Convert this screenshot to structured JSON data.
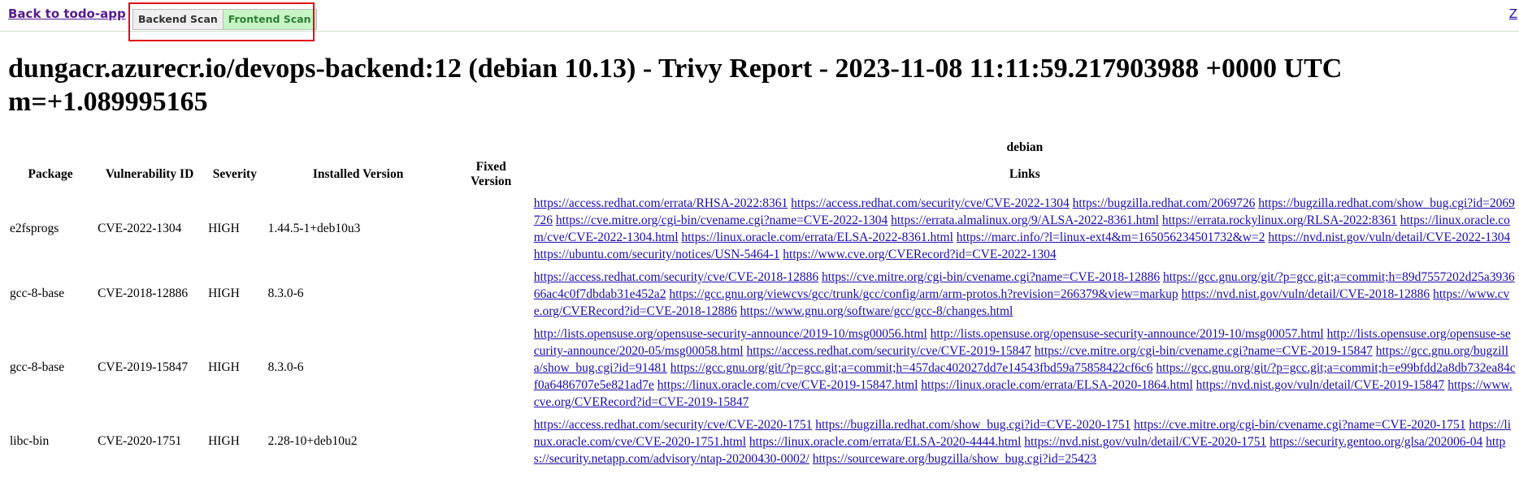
{
  "nav": {
    "back_label": "Back to todo-app",
    "right_cut_label": "Z",
    "tabs": [
      {
        "label": "Backend Scan"
      },
      {
        "label": "Frontend Scan"
      }
    ]
  },
  "report": {
    "title": "dungacr.azurecr.io/devops-backend:12 (debian 10.13) - Trivy Report - 2023-11-08 11:11:59.217903988 +0000 UTC m=+1.089995165"
  },
  "table": {
    "group_label": "debian",
    "headers": {
      "package": "Package",
      "vulnerability_id": "Vulnerability ID",
      "severity": "Severity",
      "installed_version": "Installed Version",
      "fixed_version": "Fixed Version",
      "links": "Links"
    },
    "rows": [
      {
        "package": "e2fsprogs",
        "vulnerability_id": "CVE-2022-1304",
        "severity": "HIGH",
        "installed_version": "1.44.5-1+deb10u3",
        "fixed_version": "",
        "links": [
          "https://access.redhat.com/errata/RHSA-2022:8361",
          "https://access.redhat.com/security/cve/CVE-2022-1304",
          "https://bugzilla.redhat.com/2069726",
          "https://bugzilla.redhat.com/show_bug.cgi?id=2069726",
          "https://cve.mitre.org/cgi-bin/cvename.cgi?name=CVE-2022-1304",
          "https://errata.almalinux.org/9/ALSA-2022-8361.html",
          "https://errata.rockylinux.org/RLSA-2022:8361",
          "https://linux.oracle.com/cve/CVE-2022-1304.html",
          "https://linux.oracle.com/errata/ELSA-2022-8361.html",
          "https://marc.info/?l=linux-ext4&m=165056234501732&w=2",
          "https://nvd.nist.gov/vuln/detail/CVE-2022-1304",
          "https://ubuntu.com/security/notices/USN-5464-1",
          "https://www.cve.org/CVERecord?id=CVE-2022-1304"
        ]
      },
      {
        "package": "gcc-8-base",
        "vulnerability_id": "CVE-2018-12886",
        "severity": "HIGH",
        "installed_version": "8.3.0-6",
        "fixed_version": "",
        "links": [
          "https://access.redhat.com/security/cve/CVE-2018-12886",
          "https://cve.mitre.org/cgi-bin/cvename.cgi?name=CVE-2018-12886",
          "https://gcc.gnu.org/git/?p=gcc.git;a=commit;h=89d7557202d25a393666ac4c0f7dbdab31e452a2",
          "https://gcc.gnu.org/viewcvs/gcc/trunk/gcc/config/arm/arm-protos.h?revision=266379&view=markup",
          "https://nvd.nist.gov/vuln/detail/CVE-2018-12886",
          "https://www.cve.org/CVERecord?id=CVE-2018-12886",
          "https://www.gnu.org/software/gcc/gcc-8/changes.html"
        ]
      },
      {
        "package": "gcc-8-base",
        "vulnerability_id": "CVE-2019-15847",
        "severity": "HIGH",
        "installed_version": "8.3.0-6",
        "fixed_version": "",
        "links": [
          "http://lists.opensuse.org/opensuse-security-announce/2019-10/msg00056.html",
          "http://lists.opensuse.org/opensuse-security-announce/2019-10/msg00057.html",
          "http://lists.opensuse.org/opensuse-security-announce/2020-05/msg00058.html",
          "https://access.redhat.com/security/cve/CVE-2019-15847",
          "https://cve.mitre.org/cgi-bin/cvename.cgi?name=CVE-2019-15847",
          "https://gcc.gnu.org/bugzilla/show_bug.cgi?id=91481",
          "https://gcc.gnu.org/git/?p=gcc.git;a=commit;h=457dac402027dd7e14543fbd59a75858422cf6c6",
          "https://gcc.gnu.org/git/?p=gcc.git;a=commit;h=e99bfdd2a8db732ea84cf0a6486707e5e821ad7e",
          "https://linux.oracle.com/cve/CVE-2019-15847.html",
          "https://linux.oracle.com/errata/ELSA-2020-1864.html",
          "https://nvd.nist.gov/vuln/detail/CVE-2019-15847",
          "https://www.cve.org/CVERecord?id=CVE-2019-15847"
        ]
      },
      {
        "package": "libc-bin",
        "vulnerability_id": "CVE-2020-1751",
        "severity": "HIGH",
        "installed_version": "2.28-10+deb10u2",
        "fixed_version": "",
        "links": [
          "https://access.redhat.com/security/cve/CVE-2020-1751",
          "https://bugzilla.redhat.com/show_bug.cgi?id=CVE-2020-1751",
          "https://cve.mitre.org/cgi-bin/cvename.cgi?name=CVE-2020-1751",
          "https://linux.oracle.com/cve/CVE-2020-1751.html",
          "https://linux.oracle.com/errata/ELSA-2020-4444.html",
          "https://nvd.nist.gov/vuln/detail/CVE-2020-1751",
          "https://security.gentoo.org/glsa/202006-04",
          "https://security.netapp.com/advisory/ntap-20200430-0002/",
          "https://sourceware.org/bugzilla/show_bug.cgi?id=25423"
        ]
      }
    ]
  }
}
